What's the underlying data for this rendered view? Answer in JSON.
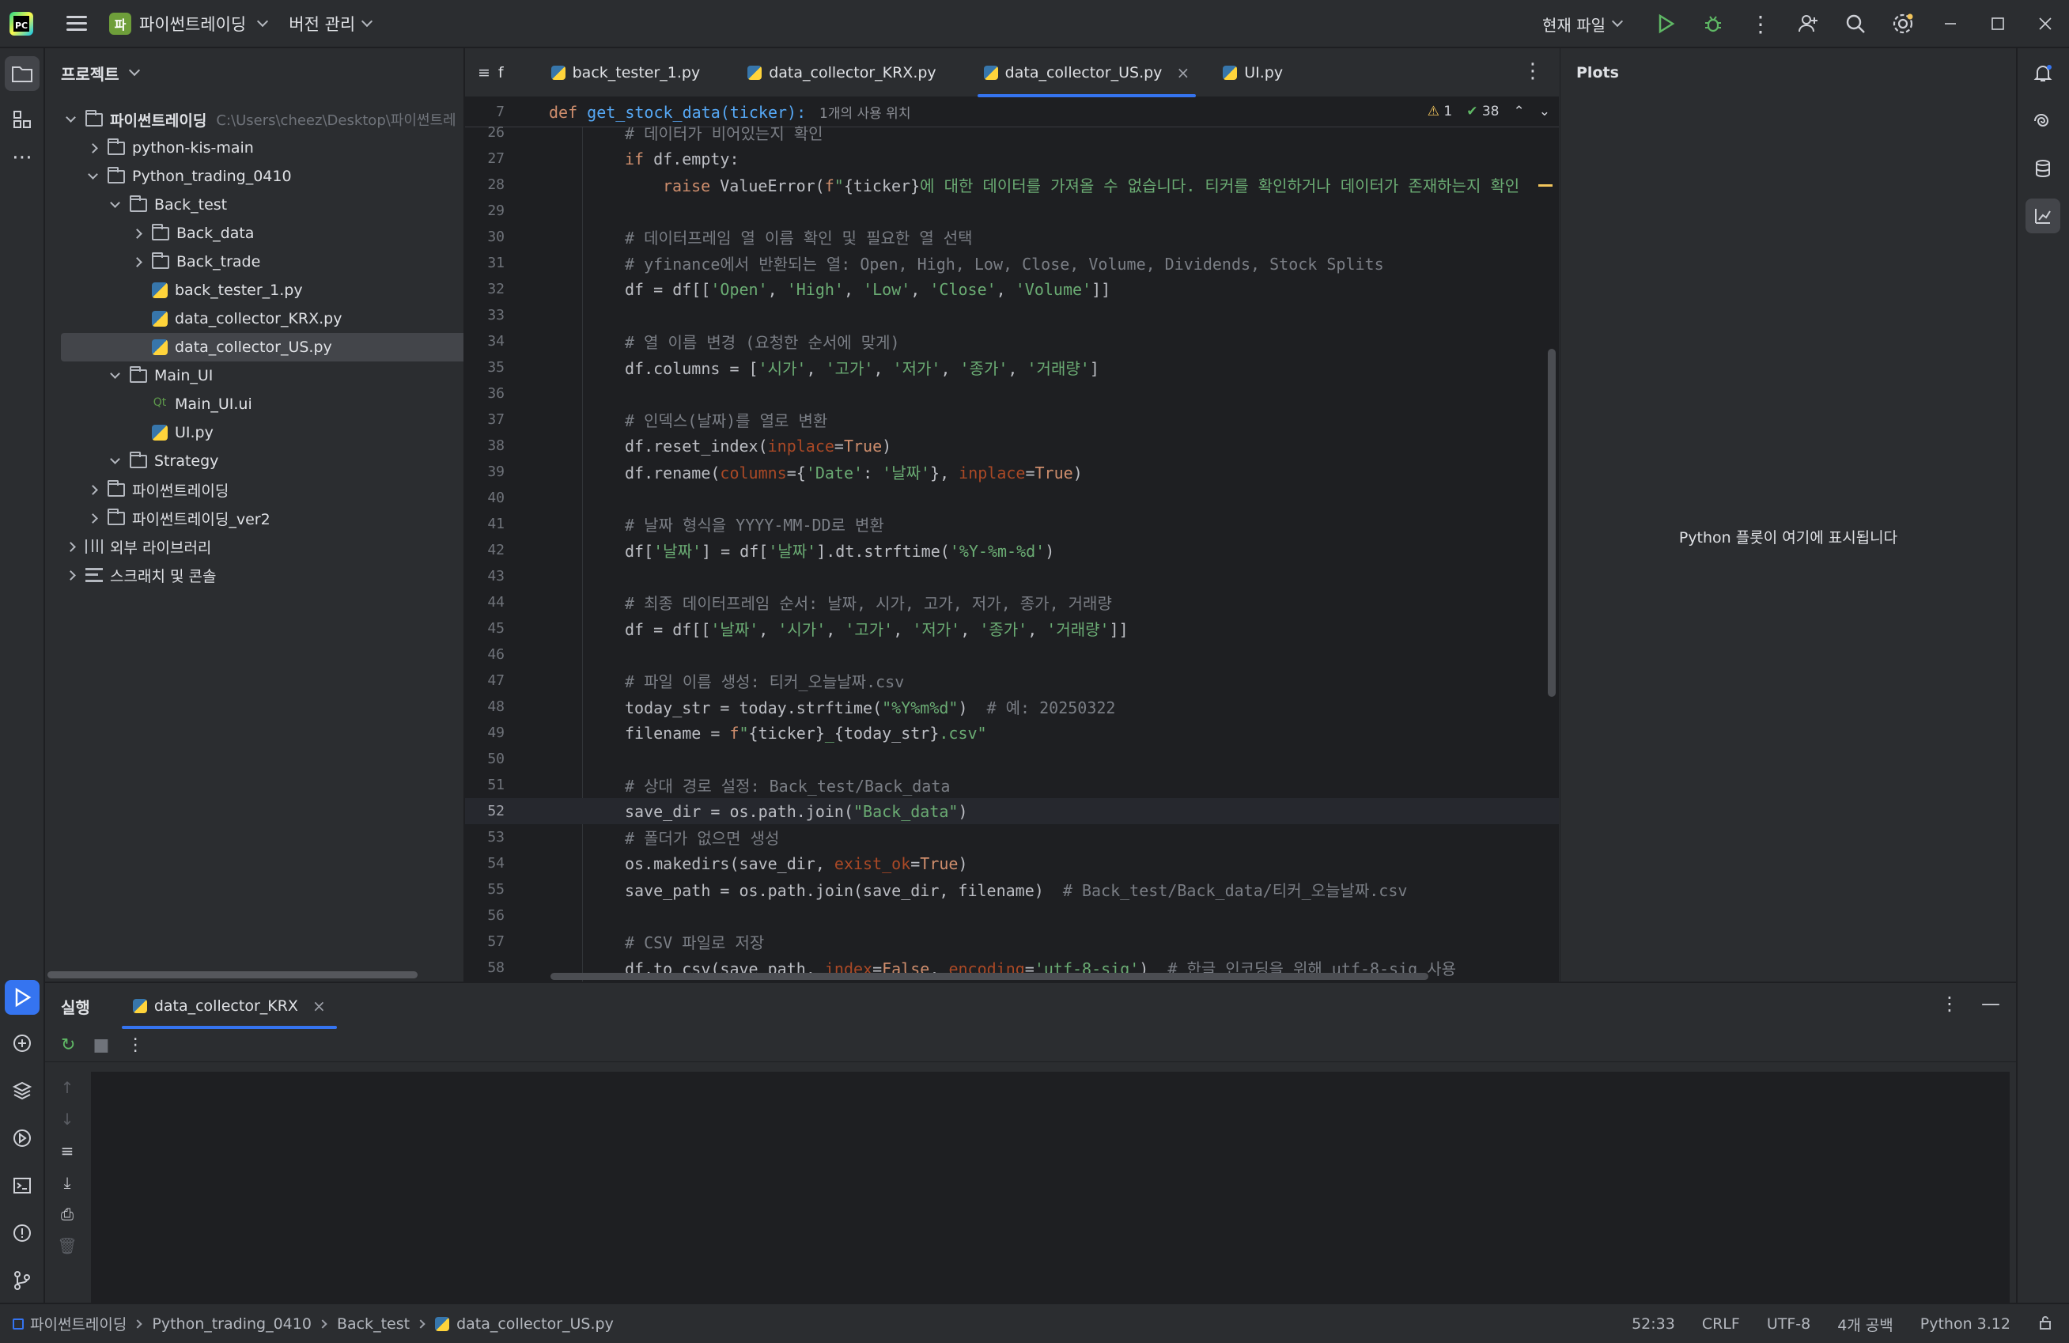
{
  "titlebar": {
    "project_badge": "파",
    "project_name": "파이썬트레이딩",
    "vcs_label": "버전 관리",
    "run_config": "현재 파일"
  },
  "project_panel": {
    "title": "프로젝트",
    "tree": [
      {
        "label": "파이썬트레이딩",
        "hint": "C:\\Users\\cheez\\Desktop\\파이썬트레",
        "bold": true,
        "level": 0,
        "type": "folder",
        "expanded": true
      },
      {
        "label": "python-kis-main",
        "level": 1,
        "type": "folder",
        "expanded": false
      },
      {
        "label": "Python_trading_0410",
        "level": 1,
        "type": "folder",
        "expanded": true
      },
      {
        "label": "Back_test",
        "level": 2,
        "type": "folder",
        "expanded": true
      },
      {
        "label": "Back_data",
        "level": 3,
        "type": "folder",
        "expanded": false
      },
      {
        "label": "Back_trade",
        "level": 3,
        "type": "folder",
        "expanded": false
      },
      {
        "label": "back_tester_1.py",
        "level": 3,
        "type": "py"
      },
      {
        "label": "data_collector_KRX.py",
        "level": 3,
        "type": "py"
      },
      {
        "label": "data_collector_US.py",
        "level": 3,
        "type": "py",
        "selected": true
      },
      {
        "label": "Main_UI",
        "level": 2,
        "type": "folder",
        "expanded": true
      },
      {
        "label": "Main_UI.ui",
        "level": 3,
        "type": "ui"
      },
      {
        "label": "UI.py",
        "level": 3,
        "type": "py"
      },
      {
        "label": "Strategy",
        "level": 2,
        "type": "folder",
        "expanded": true
      },
      {
        "label": "파이썬트레이딩",
        "level": 1,
        "type": "folder",
        "expanded": false
      },
      {
        "label": "파이썬트레이딩_ver2",
        "level": 1,
        "type": "folder",
        "expanded": false
      },
      {
        "label": "외부 라이브러리",
        "level": 0,
        "type": "lib",
        "expanded": false
      },
      {
        "label": "스크래치 및 콘솔",
        "level": 0,
        "type": "scratch",
        "expanded": false
      }
    ]
  },
  "editor": {
    "tabs": [
      {
        "label": "f",
        "icon": "structure-icon"
      },
      {
        "label": "back_tester_1.py",
        "icon": "python-icon"
      },
      {
        "label": "data_collector_KRX.py",
        "icon": "python-icon"
      },
      {
        "label": "data_collector_US.py",
        "icon": "python-icon",
        "active": true
      },
      {
        "label": "UI.py",
        "icon": "python-icon"
      }
    ],
    "sticky_line": {
      "num": "7",
      "code": "def get_stock_data(ticker):",
      "usage": "1개의 사용 위치"
    },
    "inspections": {
      "warnings": "1",
      "ok": "38"
    },
    "current_line": "52",
    "lines": [
      {
        "n": "26",
        "ind": 1,
        "html": "<span class='c'># 데이터가 비어있는지 확인</span>"
      },
      {
        "n": "27",
        "ind": 1,
        "html": "<span class='k'>if</span> df.empty:"
      },
      {
        "n": "28",
        "ind": 2,
        "html": "<span class='k'>raise</span> ValueError(<span class='k'>f</span><span class='s'>\"</span>{ticker}<span class='s'>에 대한 데이터를 가져올 수 없습니다. 티커를 확인하거나 데이터가 존재하는지 확인</span>"
      },
      {
        "n": "29",
        "ind": 0,
        "html": ""
      },
      {
        "n": "30",
        "ind": 1,
        "html": "<span class='c'># 데이터프레임 열 이름 확인 및 필요한 열 선택</span>"
      },
      {
        "n": "31",
        "ind": 1,
        "html": "<span class='c'># yfinance에서 반환되는 열: Open, High, Low, Close, Volume, Dividends, Stock Splits</span>"
      },
      {
        "n": "32",
        "ind": 1,
        "html": "df = df[[<span class='s'>'Open'</span>, <span class='s'>'High'</span>, <span class='s'>'Low'</span>, <span class='s'>'Close'</span>, <span class='s'>'Volume'</span>]]"
      },
      {
        "n": "33",
        "ind": 0,
        "html": ""
      },
      {
        "n": "34",
        "ind": 1,
        "html": "<span class='c'># 열 이름 변경 (요청한 순서에 맞게)</span>"
      },
      {
        "n": "35",
        "ind": 1,
        "html": "df.columns = [<span class='s'>'시가'</span>, <span class='s'>'고가'</span>, <span class='s'>'저가'</span>, <span class='s'>'종가'</span>, <span class='s'>'거래량'</span>]"
      },
      {
        "n": "36",
        "ind": 0,
        "html": ""
      },
      {
        "n": "37",
        "ind": 1,
        "html": "<span class='c'># 인덱스(날짜)를 열로 변환</span>"
      },
      {
        "n": "38",
        "ind": 1,
        "html": "df.reset_index(<span class='p'>inplace</span>=<span class='k'>True</span>)"
      },
      {
        "n": "39",
        "ind": 1,
        "html": "df.rename(<span class='p'>columns</span>={<span class='s'>'Date'</span>: <span class='s'>'날짜'</span>}, <span class='p'>inplace</span>=<span class='k'>True</span>)"
      },
      {
        "n": "40",
        "ind": 0,
        "html": ""
      },
      {
        "n": "41",
        "ind": 1,
        "html": "<span class='c'># 날짜 형식을 YYYY-MM-DD로 변환</span>"
      },
      {
        "n": "42",
        "ind": 1,
        "html": "df[<span class='s'>'날짜'</span>] = df[<span class='s'>'날짜'</span>].dt.strftime(<span class='s'>'%Y-%m-%d'</span>)"
      },
      {
        "n": "43",
        "ind": 0,
        "html": ""
      },
      {
        "n": "44",
        "ind": 1,
        "html": "<span class='c'># 최종 데이터프레임 순서: 날짜, 시가, 고가, 저가, 종가, 거래량</span>"
      },
      {
        "n": "45",
        "ind": 1,
        "html": "df = df[[<span class='s'>'날짜'</span>, <span class='s'>'시가'</span>, <span class='s'>'고가'</span>, <span class='s'>'저가'</span>, <span class='s'>'종가'</span>, <span class='s'>'거래량'</span>]]"
      },
      {
        "n": "46",
        "ind": 0,
        "html": ""
      },
      {
        "n": "47",
        "ind": 1,
        "html": "<span class='c'># 파일 이름 생성: 티커_오늘날짜.csv</span>"
      },
      {
        "n": "48",
        "ind": 1,
        "html": "today_str = today.strftime(<span class='s'>\"%Y%m%d\"</span>)  <span class='c'># 예: 20250322</span>"
      },
      {
        "n": "49",
        "ind": 1,
        "html": "filename = <span class='k'>f</span><span class='s'>\"</span>{ticker}<span class='s'>_</span>{today_str}<span class='s'>.csv\"</span>"
      },
      {
        "n": "50",
        "ind": 0,
        "html": ""
      },
      {
        "n": "51",
        "ind": 1,
        "html": "<span class='c'># 상대 경로 설정: Back_test/Back_data</span>"
      },
      {
        "n": "52",
        "ind": 1,
        "html": "save_dir = os.path.join(<span class='s'>\"Back_data\"</span>)"
      },
      {
        "n": "53",
        "ind": 1,
        "html": "<span class='c'># 폴더가 없으면 생성</span>"
      },
      {
        "n": "54",
        "ind": 1,
        "html": "os.makedirs(save_dir, <span class='p'>exist_ok</span>=<span class='k'>True</span>)"
      },
      {
        "n": "55",
        "ind": 1,
        "html": "save_path = os.path.join(save_dir, filename)  <span class='c'># Back_test/Back_data/티커_오늘날짜.csv</span>"
      },
      {
        "n": "56",
        "ind": 0,
        "html": ""
      },
      {
        "n": "57",
        "ind": 1,
        "html": "<span class='c'># CSV 파일로 저장</span>"
      },
      {
        "n": "58",
        "ind": 1,
        "html": "df.to_csv(save_path, <span class='p'>index</span>=<span class='k'>False</span>, <span class='p'>encoding</span>=<span class='s'>'utf-8-sig'</span>)  <span class='c'># 한글 인코딩을 위해 utf-8-sig 사용</span>"
      }
    ]
  },
  "plots": {
    "title": "Plots",
    "empty_message": "Python 플롯이 여기에 표시됩니다"
  },
  "run_panel": {
    "title": "실행",
    "tab_label": "data_collector_KRX"
  },
  "statusbar": {
    "breadcrumbs": [
      "파이썬트레이딩",
      "Python_trading_0410",
      "Back_test",
      "data_collector_US.py"
    ],
    "position": "52:33",
    "line_sep": "CRLF",
    "encoding": "UTF-8",
    "indent": "4개 공백",
    "interpreter": "Python 3.12"
  },
  "colors": {
    "accent": "#3574f0",
    "background": "#1e1f22",
    "panel": "#2b2d30"
  }
}
